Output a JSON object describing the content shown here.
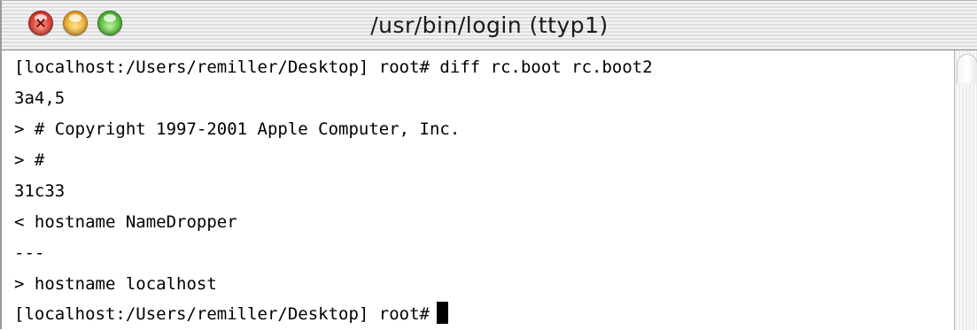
{
  "window": {
    "title": "/usr/bin/login  (ttyp1)",
    "buttons": {
      "close": "close-icon",
      "minimize": "minimize-icon",
      "zoom": "zoom-icon"
    }
  },
  "terminal": {
    "lines": [
      "[localhost:/Users/remiller/Desktop] root# diff rc.boot rc.boot2",
      "3a4,5",
      "> # Copyright 1997-2001 Apple Computer, Inc.",
      "> #",
      "31c33",
      "< hostname NameDropper",
      "---",
      "> hostname localhost",
      "[localhost:/Users/remiller/Desktop] root#"
    ],
    "cursor": "block-cursor"
  },
  "colors": {
    "text": "#000000",
    "background": "#ffffff",
    "close_button": "#e0443a",
    "minimize_button": "#f2b13a",
    "zoom_button": "#5cc23c"
  }
}
